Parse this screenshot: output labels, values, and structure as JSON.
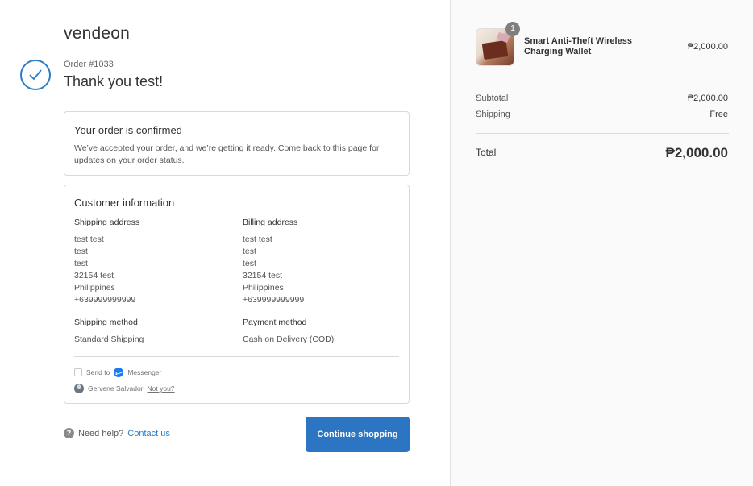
{
  "store": {
    "name": "vendeon"
  },
  "order": {
    "number": "Order #1033",
    "thank_you": "Thank you test!"
  },
  "confirmed": {
    "title": "Your order is confirmed",
    "text": "We’ve accepted your order, and we’re getting it ready. Come back to this page for updates on your order status."
  },
  "customer": {
    "title": "Customer information",
    "shipping_address": {
      "heading": "Shipping address",
      "lines": [
        "test test",
        "test",
        "test",
        "32154 test",
        "Philippines",
        "+639999999999"
      ]
    },
    "billing_address": {
      "heading": "Billing address",
      "lines": [
        "test test",
        "test",
        "test",
        "32154 test",
        "Philippines",
        "+639999999999"
      ]
    },
    "shipping_method": {
      "heading": "Shipping method",
      "value": "Standard Shipping"
    },
    "payment_method": {
      "heading": "Payment method",
      "value": "Cash on Delivery (COD)"
    },
    "messenger": {
      "send_to": "Send to",
      "app": "Messenger",
      "user": "Gervene Salvador",
      "not_you": "Not you?"
    }
  },
  "help": {
    "text": "Need help?",
    "link": "Contact us",
    "icon": "question-icon"
  },
  "continue_button": "Continue shopping",
  "cart": {
    "item": {
      "name": "Smart Anti-Theft Wireless Charging Wallet",
      "quantity": "1",
      "price": "₱2,000.00"
    },
    "subtotal_label": "Subtotal",
    "subtotal_value": "₱2,000.00",
    "shipping_label": "Shipping",
    "shipping_value": "Free",
    "total_label": "Total",
    "total_value": "₱2,000.00"
  },
  "colors": {
    "accent": "#2b75c2",
    "sidebar_bg": "#fafafa"
  }
}
